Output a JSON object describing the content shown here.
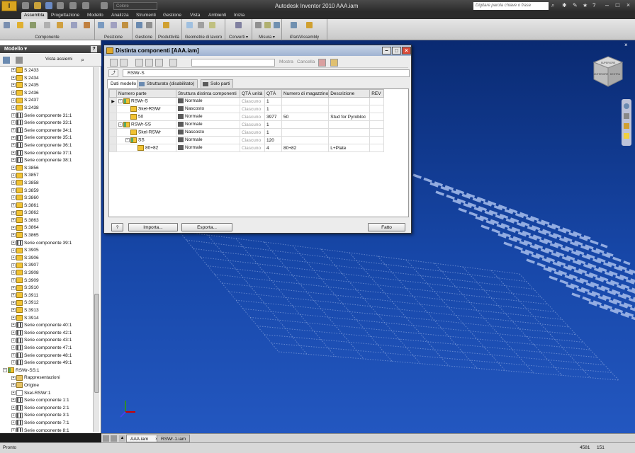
{
  "app": {
    "title": "Autodesk Inventor 2010    AAA.iam",
    "logo": "I",
    "style_select": "Colore",
    "search_placeholder": "Digitare parola chiave o frase",
    "window_controls": [
      "–",
      "□",
      "×"
    ]
  },
  "ribbon_tabs": [
    "Assembla",
    "Progettazione",
    "Modello",
    "Analizza",
    "Strumenti",
    "Gestione",
    "Vista",
    "Ambienti",
    "Inizia"
  ],
  "ribbon_groups": [
    "Componente",
    "Posizione",
    "Gestione",
    "Produttività",
    "Geometrie di lavoro",
    "Converti ▾",
    "Misura ▾",
    "iPart/iAssembly"
  ],
  "browser": {
    "title": "Modello ▾",
    "help": "?",
    "view": "Vista assiemi",
    "items": [
      {
        "icon": "part",
        "label": "S:2433"
      },
      {
        "icon": "part",
        "label": "S:2434"
      },
      {
        "icon": "part",
        "label": "S:2435"
      },
      {
        "icon": "part",
        "label": "S:2436"
      },
      {
        "icon": "part",
        "label": "S:2437"
      },
      {
        "icon": "part",
        "label": "S:2438"
      },
      {
        "icon": "pattern",
        "label": "Serie componente 31:1"
      },
      {
        "icon": "pattern",
        "label": "Serie componente 33:1"
      },
      {
        "icon": "pattern",
        "label": "Serie componente 34:1"
      },
      {
        "icon": "pattern",
        "label": "Serie componente 35:1"
      },
      {
        "icon": "pattern",
        "label": "Serie componente 36:1"
      },
      {
        "icon": "pattern",
        "label": "Serie componente 37:1"
      },
      {
        "icon": "pattern",
        "label": "Serie componente 38:1"
      },
      {
        "icon": "part",
        "label": "S:3856"
      },
      {
        "icon": "part",
        "label": "S:3857"
      },
      {
        "icon": "part",
        "label": "S:3858"
      },
      {
        "icon": "part",
        "label": "S:3859"
      },
      {
        "icon": "part",
        "label": "S:3860"
      },
      {
        "icon": "part",
        "label": "S:3861"
      },
      {
        "icon": "part",
        "label": "S:3862"
      },
      {
        "icon": "part",
        "label": "S:3863"
      },
      {
        "icon": "part",
        "label": "S:3864"
      },
      {
        "icon": "part",
        "label": "S:3865"
      },
      {
        "icon": "pattern",
        "label": "Serie componente 39:1"
      },
      {
        "icon": "part",
        "label": "S:3905"
      },
      {
        "icon": "part",
        "label": "S:3906"
      },
      {
        "icon": "part",
        "label": "S:3907"
      },
      {
        "icon": "part",
        "label": "S:3908"
      },
      {
        "icon": "part",
        "label": "S:3909"
      },
      {
        "icon": "part",
        "label": "S:3910"
      },
      {
        "icon": "part",
        "label": "S:3911"
      },
      {
        "icon": "part",
        "label": "S:3912"
      },
      {
        "icon": "part",
        "label": "S:3913"
      },
      {
        "icon": "part",
        "label": "S:3914"
      },
      {
        "icon": "pattern",
        "label": "Serie componente 40:1"
      },
      {
        "icon": "pattern",
        "label": "Serie componente 42:1"
      },
      {
        "icon": "pattern",
        "label": "Serie componente 43:1"
      },
      {
        "icon": "pattern",
        "label": "Serie componente 47:1"
      },
      {
        "icon": "pattern",
        "label": "Serie componente 48:1"
      },
      {
        "icon": "pattern",
        "label": "Serie componente 49:1"
      },
      {
        "icon": "asm",
        "label": "RSWr-SS:1",
        "root": true
      },
      {
        "icon": "folder",
        "label": "Rappresentazioni"
      },
      {
        "icon": "folder",
        "label": "Origine"
      },
      {
        "icon": "origin",
        "label": "Skel-RSWr:1"
      },
      {
        "icon": "pattern",
        "label": "Serie componente 1:1"
      },
      {
        "icon": "pattern",
        "label": "Serie componente 2:1"
      },
      {
        "icon": "pattern",
        "label": "Serie componente 3:1"
      },
      {
        "icon": "pattern",
        "label": "Serie componente 7:1"
      },
      {
        "icon": "pattern",
        "label": "Serie componente 8:1"
      }
    ]
  },
  "dialog": {
    "title": "Distinta componenti [AAA.iam]",
    "toolbar_labels": [
      "Mostra",
      "Cancella"
    ],
    "assembly_field": "RSWr-S",
    "tabs": [
      "Dati modello",
      "Strutturato (disabilitato)",
      "Solo parti"
    ],
    "columns": [
      "Numero parte",
      "Struttura distinta componenti",
      "QTÀ unità",
      "QTÀ",
      "Numero di magazzino",
      "Descrizione",
      "REV"
    ],
    "rows": [
      {
        "marker": "▶",
        "indent": 0,
        "expander": "−",
        "icon": "asm",
        "part": "RSWr-S",
        "structure": "Normale",
        "unit": "Ciascuno",
        "qty": "1",
        "stock": "",
        "desc": "",
        "rev": ""
      },
      {
        "marker": "",
        "indent": 1,
        "expander": "",
        "icon": "part",
        "part": "Skel-RSWr",
        "structure": "Nascosto",
        "unit": "Ciascuno",
        "qty": "1",
        "stock": "",
        "desc": "",
        "rev": ""
      },
      {
        "marker": "",
        "indent": 1,
        "expander": "",
        "icon": "part",
        "part": "50",
        "structure": "Normale",
        "unit": "Ciascuno",
        "qty": "3977",
        "stock": "50",
        "desc": "Stud for Pyrobloc",
        "rev": ""
      },
      {
        "marker": "",
        "indent": 0,
        "expander": "−",
        "icon": "asm",
        "part": "RSWr-SS",
        "structure": "Normale",
        "unit": "Ciascuno",
        "qty": "1",
        "stock": "",
        "desc": "",
        "rev": ""
      },
      {
        "marker": "",
        "indent": 1,
        "expander": "",
        "icon": "part",
        "part": "Skel-RSWr",
        "structure": "Nascosto",
        "unit": "Ciascuno",
        "qty": "1",
        "stock": "",
        "desc": "",
        "rev": ""
      },
      {
        "marker": "",
        "indent": 1,
        "expander": "−",
        "icon": "asm",
        "part": "SS",
        "structure": "Normale",
        "unit": "Ciascuno",
        "qty": "120",
        "stock": "",
        "desc": "",
        "rev": ""
      },
      {
        "marker": "",
        "indent": 2,
        "expander": "",
        "icon": "part",
        "part": "80+82",
        "structure": "Normale",
        "unit": "Ciascuno",
        "qty": "4",
        "stock": "80+82",
        "desc": "L+Plate",
        "rev": ""
      }
    ],
    "buttons": {
      "help": "?",
      "import": "Importa...",
      "export": "Esporta...",
      "done": "Fatto"
    }
  },
  "viewcube": {
    "top": "SUPERIORE",
    "front": "ANTERIORE",
    "side": "DESTRA"
  },
  "document_tabs": [
    "AAA.iam",
    "RSWr-1.iam"
  ],
  "status": {
    "text": "Pronto",
    "count1": "4581",
    "count2": "151"
  },
  "colors": {
    "viewport_top": "#0a2a72",
    "viewport_bottom": "#2357c0",
    "wire": "#9fb7e8"
  }
}
